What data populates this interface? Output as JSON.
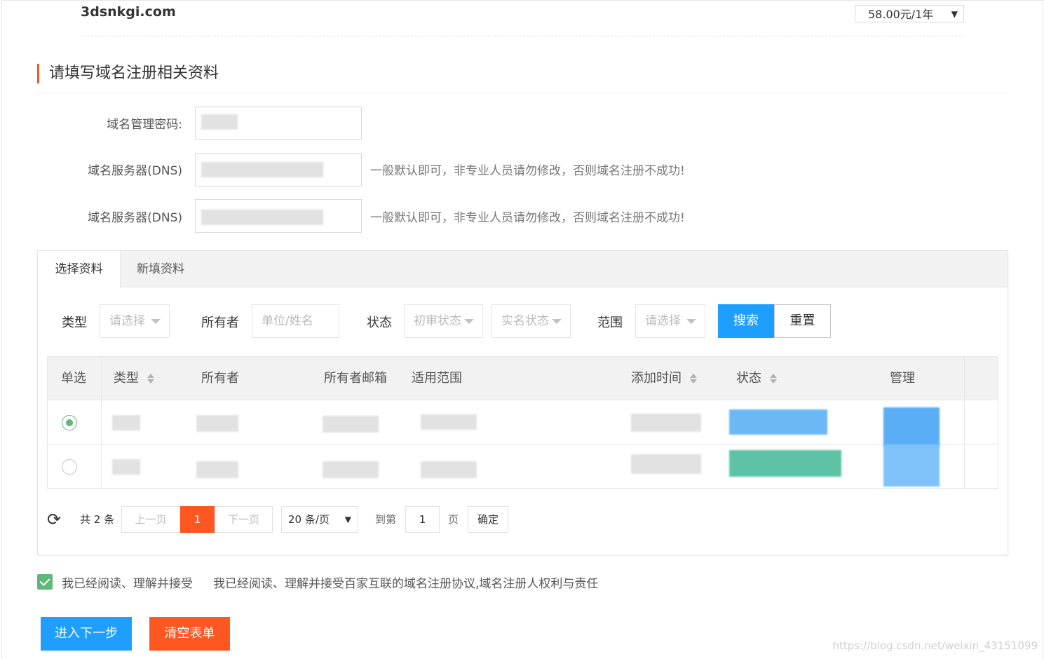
{
  "domain": {
    "name": "3dsnkgi.com",
    "price_option": "58.00元/1年"
  },
  "section": {
    "title": "请填写域名注册相关资料"
  },
  "form": {
    "password_label": "域名管理密码:",
    "dns1_label": "域名服务器(DNS)",
    "dns2_label": "域名服务器(DNS)",
    "dns_hint": "一般默认即可，非专业人员请勿修改，否则域名注册不成功!"
  },
  "tabs": {
    "select": "选择资料",
    "new": "新填资料"
  },
  "filters": {
    "type_label": "类型",
    "type_placeholder": "请选择",
    "owner_label": "所有者",
    "owner_placeholder": "单位/姓名",
    "status_label": "状态",
    "status1_placeholder": "初审状态",
    "status2_placeholder": "实名状态",
    "scope_label": "范围",
    "scope_placeholder": "请选择",
    "search_button": "搜索",
    "reset_button": "重置"
  },
  "table": {
    "headers": {
      "select": "单选",
      "type": "类型",
      "owner": "所有者",
      "email": "所有者邮箱",
      "scope": "适用范围",
      "added": "添加时间",
      "status": "状态",
      "manage": "管理"
    },
    "rows": [
      {
        "selected": true
      },
      {
        "selected": false
      }
    ]
  },
  "pager": {
    "total": "共 2 条",
    "prev": "上一页",
    "current": "1",
    "next": "下一页",
    "per_page": "20 条/页",
    "goto": "到第",
    "goto_value": "1",
    "page_unit": "页",
    "confirm": "确定"
  },
  "agreement": {
    "label": "我已经阅读、理解并接受",
    "text": "我已经阅读、理解并接受百家互联的域名注册协议,域名注册人权利与责任"
  },
  "actions": {
    "next": "进入下一步",
    "clear": "清空表单"
  },
  "watermark": "https://blog.csdn.net/weixin_43151099",
  "colors": {
    "primary": "#1e9fff",
    "danger": "#ff5722",
    "success": "#5fb878",
    "accent_bar": "#f05a28"
  }
}
